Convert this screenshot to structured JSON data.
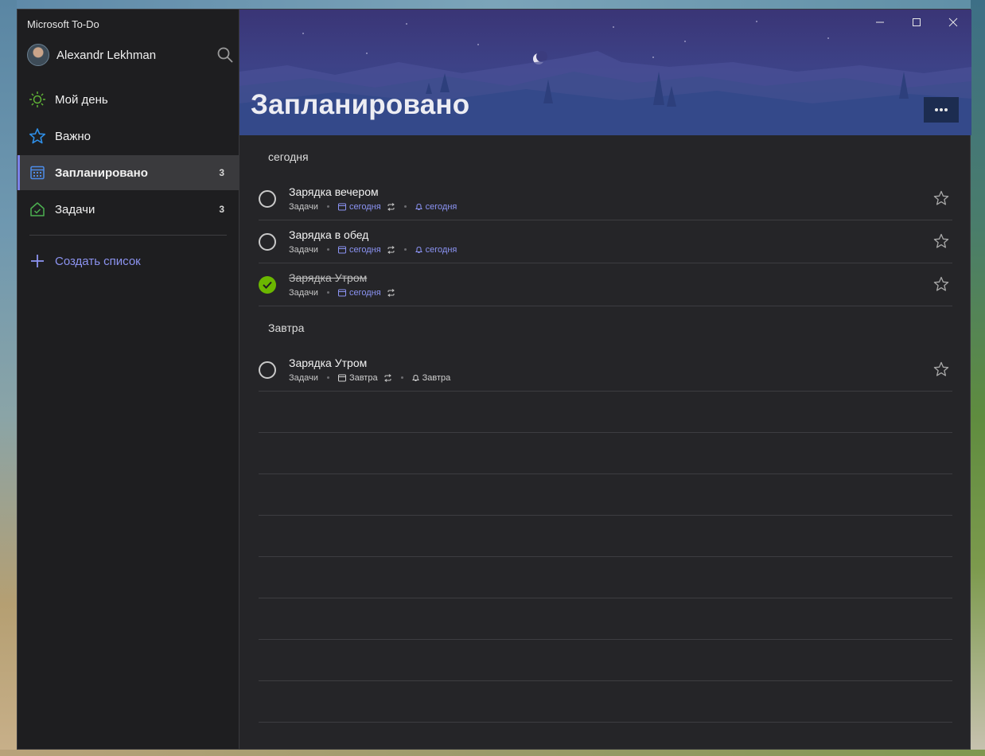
{
  "app": {
    "title": "Microsoft To-Do"
  },
  "user": {
    "name": "Alexandr Lekhman"
  },
  "sidebar": {
    "items": [
      {
        "label": "Мой день",
        "icon": "sun-icon",
        "count": ""
      },
      {
        "label": "Важно",
        "icon": "star-icon",
        "count": ""
      },
      {
        "label": "Запланировано",
        "icon": "calendar-icon",
        "count": "3",
        "active": true
      },
      {
        "label": "Задачи",
        "icon": "home-icon",
        "count": "3"
      }
    ],
    "create_list_label": "Создать список"
  },
  "header": {
    "title": "Запланировано"
  },
  "sections": [
    {
      "label": "сегодня",
      "tasks": [
        {
          "title": "Зарядка вечером",
          "list": "Задачи",
          "due": "сегодня",
          "repeat": true,
          "reminder": "сегодня",
          "completed": false
        },
        {
          "title": "Зарядка в обед",
          "list": "Задачи",
          "due": "сегодня",
          "repeat": true,
          "reminder": "сегодня",
          "completed": false
        },
        {
          "title": "Зарядка Утром",
          "list": "Задачи",
          "due": "сегодня",
          "repeat": true,
          "reminder": "",
          "completed": true
        }
      ]
    },
    {
      "label": "Завтра",
      "tasks": [
        {
          "title": "Зарядка Утром",
          "list": "Задачи",
          "due": "Завтра",
          "repeat": true,
          "reminder": "Завтра",
          "completed": false
        }
      ]
    }
  ],
  "colors": {
    "accent": "#7b82e8",
    "link": "#8b93f3",
    "complete": "#6bb700",
    "sun": "#5fb236",
    "star": "#2f8fe8",
    "home": "#4caf50"
  }
}
